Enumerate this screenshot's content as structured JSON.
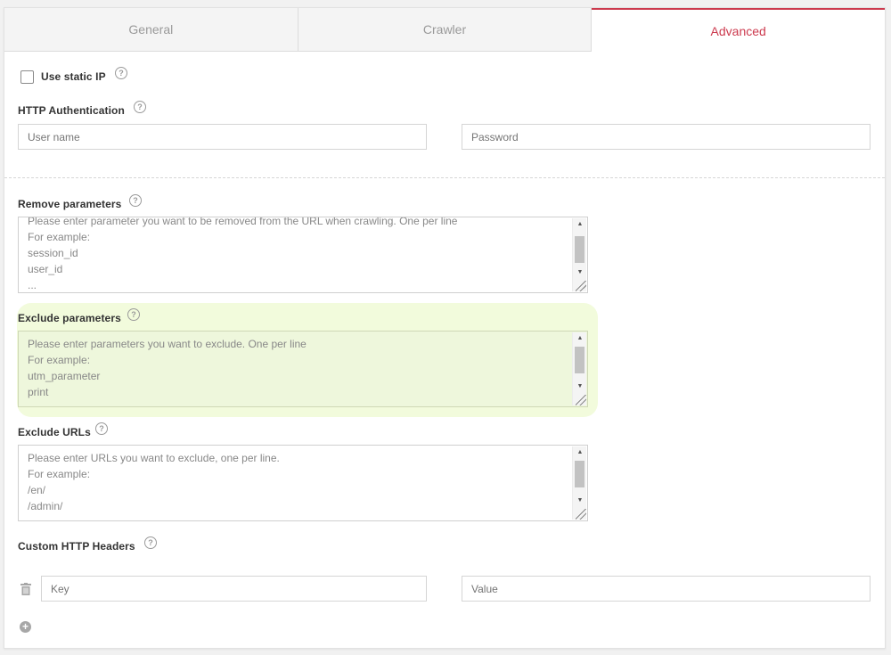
{
  "tabs": [
    {
      "label": "General"
    },
    {
      "label": "Crawler"
    },
    {
      "label": "Advanced"
    }
  ],
  "static_ip": {
    "label": "Use static IP",
    "checked": false
  },
  "http_auth": {
    "label": "HTTP Authentication",
    "username_placeholder": "User name",
    "password_placeholder": "Password"
  },
  "remove_params": {
    "label": "Remove parameters",
    "lines": [
      "Please enter parameter you want to be removed from the URL when crawling. One per line",
      "For example:",
      "session_id",
      "user_id",
      "..."
    ]
  },
  "exclude_params": {
    "label": "Exclude parameters",
    "lines": [
      "Please enter parameters you want to exclude. One per line",
      "For example:",
      "utm_parameter",
      "print"
    ]
  },
  "exclude_urls": {
    "label": "Exclude URLs",
    "lines": [
      "Please enter URLs you want to exclude, one per line.",
      "For example:",
      "/en/",
      "/admin/"
    ]
  },
  "custom_headers": {
    "label": "Custom HTTP Headers",
    "key_placeholder": "Key",
    "value_placeholder": "Value"
  },
  "icons": {
    "help": "question-circle-icon",
    "delete": "trash-icon",
    "add": "plus-circle-icon"
  },
  "colors": {
    "accent": "#cc3a4e",
    "highlight": "#f2fbdc"
  }
}
